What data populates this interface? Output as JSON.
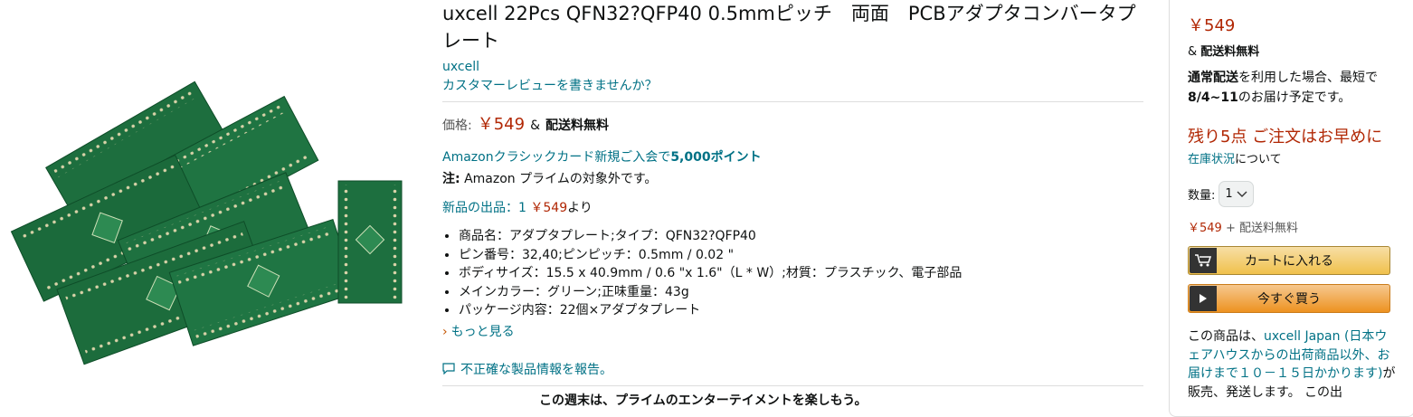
{
  "product": {
    "title": "uxcell 22Pcs QFN32?QFP40 0.5mmピッチ　両面　PCBアダプタコンバータプレート",
    "brand": "uxcell",
    "review_link": "カスタマーレビューを書きませんか？"
  },
  "pricing": {
    "label": "価格:",
    "price": "￥549",
    "amp": "&",
    "free_shipping": "配送料無料"
  },
  "promo": {
    "text": "Amazonクラシックカード新規ご入会で",
    "points": "5,000ポイント"
  },
  "note": {
    "label": "注:",
    "text": "Amazon プライムの対象外です。"
  },
  "offers": {
    "prefix": "新品の出品：",
    "count": "1",
    "price": "￥549",
    "suffix": "より"
  },
  "bullets": [
    "商品名：アダプタプレート;タイプ：QFN32?QFP40",
    "ピン番号：32,40;ピンピッチ：0.5mm / 0.02 \"",
    "ボディサイズ：15.5 x 40.9mm / 0.6 \"x 1.6\"（L * W）;材質：プラスチック、電子部品",
    "メインカラー：グリーン;正味重量：43g",
    "パッケージ内容：22個×アダプタプレート"
  ],
  "more_link": "もっと見る",
  "report_link": "不正確な製品情報を報告。",
  "prime_promo": "この週末は、プライムのエンターテイメントを楽しもう。",
  "buybox": {
    "price": "￥549",
    "amp": "&",
    "free_shipping": "配送料無料",
    "delivery_a": "通常配送",
    "delivery_b": "を利用した場合、最短で",
    "delivery_date": "8/4~11",
    "delivery_c": "のお届け予定です。",
    "stock": "残り5点 ご注文はお早めに",
    "stock_link": "在庫状況",
    "stock_suffix": "について",
    "qty_label": "数量:",
    "qty_value": "1",
    "price2": "￥549",
    "price2_suffix": "+ 配送料無料",
    "cart_button": "カートに入れる",
    "buy_button": "今すぐ買う",
    "seller_prefix": "この商品は、",
    "seller_link": "uxcell Japan (日本ウェアハウスからの出荷商品以外、お届けまで１０－１５日かかります)",
    "seller_suffix": "が販売、発送します。 この出"
  },
  "colors": {
    "link": "#007185",
    "price": "#b12704",
    "pcb_green": "#1a6b3a"
  }
}
